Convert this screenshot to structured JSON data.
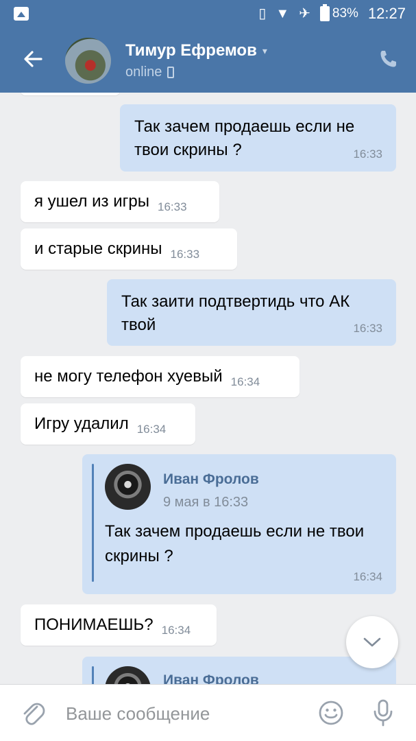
{
  "status_bar": {
    "battery": "83%",
    "time": "12:27"
  },
  "header": {
    "contact_name": "Тимур Ефремов",
    "presence": "online"
  },
  "messages": [
    {
      "direction": "out",
      "text": "Так зачем продаешь если не твои скрины ?",
      "time": "16:33"
    },
    {
      "direction": "in",
      "text": "я ушел из игры",
      "time": "16:33"
    },
    {
      "direction": "in",
      "text": "и старые скрины",
      "time": "16:33"
    },
    {
      "direction": "out",
      "text": "Так заити подтвертидь что АК твой",
      "time": "16:33"
    },
    {
      "direction": "in",
      "text": "не могу телефон хуевый",
      "time": "16:34"
    },
    {
      "direction": "in",
      "text": "Игру удалил",
      "time": "16:34"
    },
    {
      "direction": "out",
      "forwarded": {
        "author": "Иван Фролов",
        "date": "9 мая в 16:33",
        "text": "Так зачем продаешь если не твои скрины ?"
      },
      "time": "16:34"
    },
    {
      "direction": "in",
      "text": "ПОНИМАЕШЬ?",
      "time": "16:34"
    },
    {
      "direction": "out",
      "forwarded": {
        "author": "Иван Фролов"
      }
    }
  ],
  "composer": {
    "placeholder": "Ваше сообщение"
  },
  "icons": {
    "attach": "paperclip-icon",
    "emoji": "emoji-icon",
    "voice": "microphone-icon",
    "call": "phone-icon",
    "back": "back-arrow-icon",
    "scroll": "chevron-down-icon"
  },
  "colors": {
    "header": "#4a76a8",
    "outgoing_bubble": "#cfe0f5",
    "incoming_bubble": "#ffffff",
    "background": "#edeef0",
    "timestamp": "#818c99",
    "forward_author": "#4a6d96"
  }
}
